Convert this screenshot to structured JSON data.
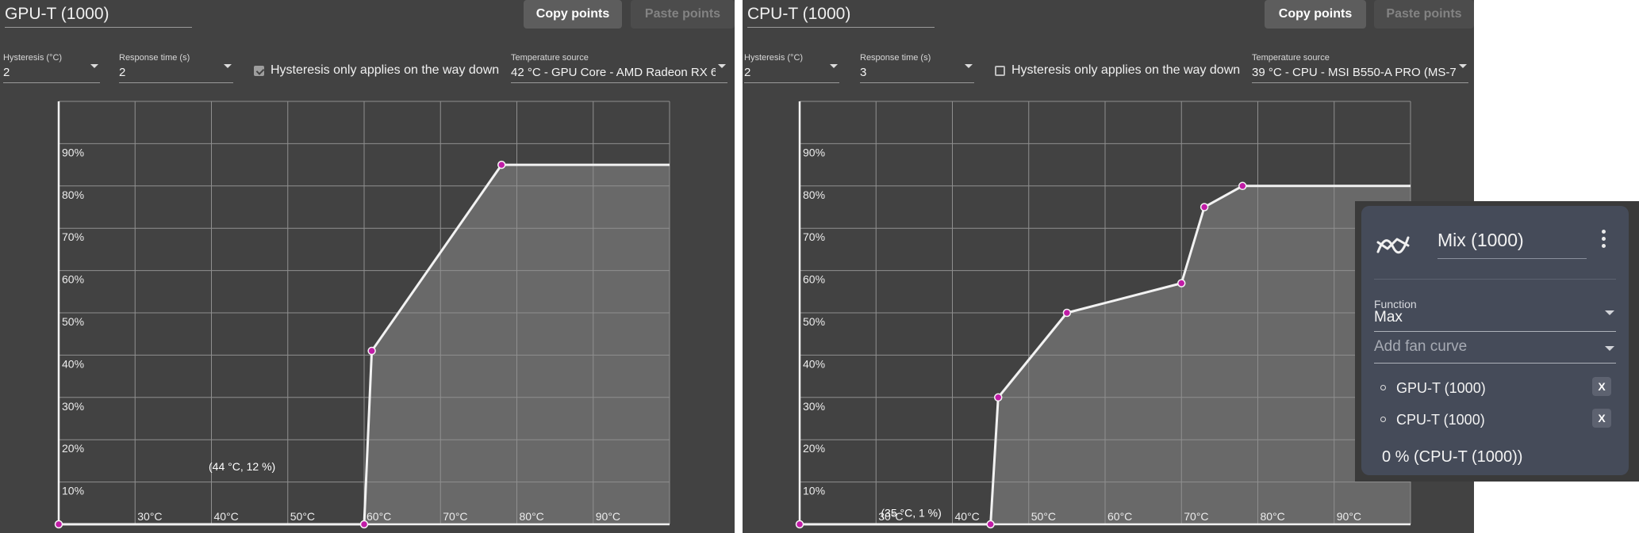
{
  "panels": [
    {
      "name": "GPU-T (1000)",
      "copy_label": "Copy points",
      "paste_label": "Paste points",
      "hysteresis": {
        "label": "Hysteresis (°C)",
        "value": "2"
      },
      "response": {
        "label": "Response time (s)",
        "value": "2"
      },
      "hysteresis_down": {
        "label": "Hysteresis only applies on the way down",
        "checked": true
      },
      "source": {
        "label": "Temperature source",
        "value": "42 °C - GPU Core - AMD Radeon RX 6"
      },
      "chart_data": {
        "type": "area",
        "x_ticks": [
          "30°C",
          "40°C",
          "50°C",
          "60°C",
          "70°C",
          "80°C",
          "90°C"
        ],
        "y_ticks": [
          "10%",
          "20%",
          "30%",
          "40%",
          "50%",
          "60%",
          "70%",
          "80%",
          "90%"
        ],
        "xlim": [
          20,
          100
        ],
        "ylim": [
          0,
          100
        ],
        "grid": true,
        "points": [
          [
            20,
            0
          ],
          [
            60,
            0
          ],
          [
            61,
            41
          ],
          [
            78,
            85
          ]
        ],
        "extend_to_x": 100,
        "annotation": {
          "text": "(44 °C, 12 %)",
          "x": 44,
          "y": 12
        }
      }
    },
    {
      "name": "CPU-T (1000)",
      "copy_label": "Copy points",
      "paste_label": "Paste points",
      "hysteresis": {
        "label": "Hysteresis (°C)",
        "value": "2"
      },
      "response": {
        "label": "Response time (s)",
        "value": "3"
      },
      "hysteresis_down": {
        "label": "Hysteresis only applies on the way down",
        "checked": false
      },
      "source": {
        "label": "Temperature source",
        "value": "39 °C - CPU - MSI B550-A PRO (MS-7C"
      },
      "chart_data": {
        "type": "area",
        "x_ticks": [
          "30°C",
          "40°C",
          "50°C",
          "60°C",
          "70°C",
          "80°C",
          "90°C"
        ],
        "y_ticks": [
          "10%",
          "20%",
          "30%",
          "40%",
          "50%",
          "60%",
          "70%",
          "80%",
          "90%"
        ],
        "xlim": [
          20,
          100
        ],
        "ylim": [
          0,
          100
        ],
        "grid": true,
        "points": [
          [
            20,
            0
          ],
          [
            45,
            0
          ],
          [
            46,
            30
          ],
          [
            55,
            50
          ],
          [
            70,
            57
          ],
          [
            73,
            75
          ],
          [
            78,
            80
          ]
        ],
        "extend_to_x": 100,
        "annotation": {
          "text": "(35 °C, 1 %)",
          "x": 35,
          "y": 1
        }
      }
    }
  ],
  "mix": {
    "title": "Mix (1000)",
    "function_label": "Function",
    "function_value": "Max",
    "add_placeholder": "Add fan curve",
    "curves": [
      {
        "label": "GPU-T (1000)",
        "remove": "X"
      },
      {
        "label": "CPU-T (1000)",
        "remove": "X"
      }
    ],
    "status": "0 % (CPU-T (1000))"
  },
  "colors": {
    "panel_bg": "#424242",
    "fill": "#696969",
    "line": "#f2f2f2",
    "point": "#c01ca6",
    "grid": "#8f8f8f",
    "mix_bg": "#454b59"
  }
}
